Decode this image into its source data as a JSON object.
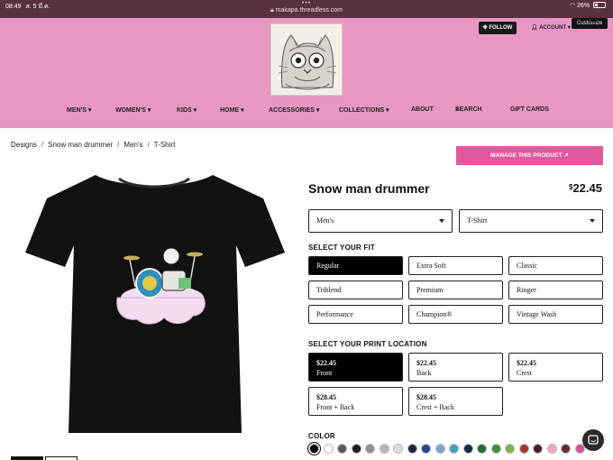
{
  "status_bar": {
    "time": "08:49",
    "date": "ส. 5 มี.ค.",
    "dots": "•••",
    "url": "makapa.threadless.com",
    "battery": "26%"
  },
  "header": {
    "follow_label": "✚ FOLLOW",
    "account_label": "ACCOUNT",
    "customize_label": "Customize",
    "nav": [
      "MEN'S ▾",
      "WOMEN'S ▾",
      "KIDS ▾",
      "HOME ▾",
      "ACCESSORIES ▾",
      "COLLECTIONS ▾",
      "ABOUT",
      "SEARCH",
      "GIFT CARDS"
    ]
  },
  "breadcrumb": [
    "Designs",
    "Snow man drummer",
    "Men's",
    "T-Shirt"
  ],
  "manage_label": "MANAGE THIS PRODUCT",
  "product": {
    "title": "Snow man drummer",
    "currency": "$",
    "price": "22.45"
  },
  "selects": {
    "gender": "Men's",
    "style": "T-Shirt"
  },
  "fit": {
    "label": "SELECT YOUR FIT",
    "options": [
      "Regular",
      "Extra Soft",
      "Classic",
      "Triblend",
      "Premium",
      "Ringer",
      "Performance",
      "Champion®",
      "Vintage Wash"
    ],
    "selected": "Regular"
  },
  "print_location": {
    "label": "SELECT YOUR PRINT LOCATION",
    "options": [
      {
        "price": "$22.45",
        "name": "Front"
      },
      {
        "price": "$22.45",
        "name": "Back"
      },
      {
        "price": "$22.45",
        "name": "Crest"
      },
      {
        "price": "$28.45",
        "name": "Front + Back"
      },
      {
        "price": "$28.45",
        "name": "Crest + Back"
      }
    ],
    "selected": "Front"
  },
  "color": {
    "label": "COLOR",
    "swatches": [
      "#000000",
      "#ffffff",
      "#5a5a5a",
      "#1c1c1c",
      "#8f8f8f",
      "#b8b8b8",
      "#dcdcdc",
      "#1b2340",
      "#2a3f8f",
      "#7fa6cf",
      "#3aa0c8",
      "#0e2a4a",
      "#1f6b3a",
      "#4a8a3a",
      "#7fb24a",
      "#a83232",
      "#4a1a24",
      "#f2a7c0",
      "#6a2a2a",
      "#d94fa0"
    ],
    "selected": "#000000"
  }
}
